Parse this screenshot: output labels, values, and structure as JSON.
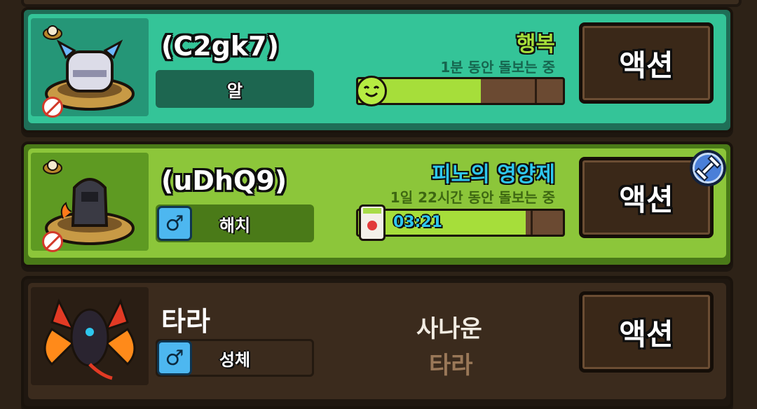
{
  "pets": [
    {
      "name": "(C2gk7)",
      "stage": "알",
      "status_title": "행복",
      "status_sub": "1분 동안 돌보는 중",
      "progress": 0.6,
      "bar_text": "",
      "action_label": "액션",
      "has_gender": false
    },
    {
      "name": "(uDhQ9)",
      "stage": "해치",
      "status_title": "피노의 영양제",
      "status_sub": "1일 22시간 동안 돌보는 중",
      "progress": 0.82,
      "bar_text": "03:21",
      "action_label": "액션",
      "has_gender": true,
      "gender_icon": "male-icon"
    },
    {
      "name": "타라",
      "stage": "성체",
      "trait": "사나운",
      "species": "타라",
      "action_label": "액션",
      "has_gender": true,
      "gender_icon": "male-icon"
    }
  ],
  "colors": {
    "card1_bg": "#34c498",
    "card2_bg": "#8cc63a",
    "card3_bg": "#3b2b1d",
    "status1_title": "#a6e03a",
    "status2_title": "#2ec7ee"
  }
}
